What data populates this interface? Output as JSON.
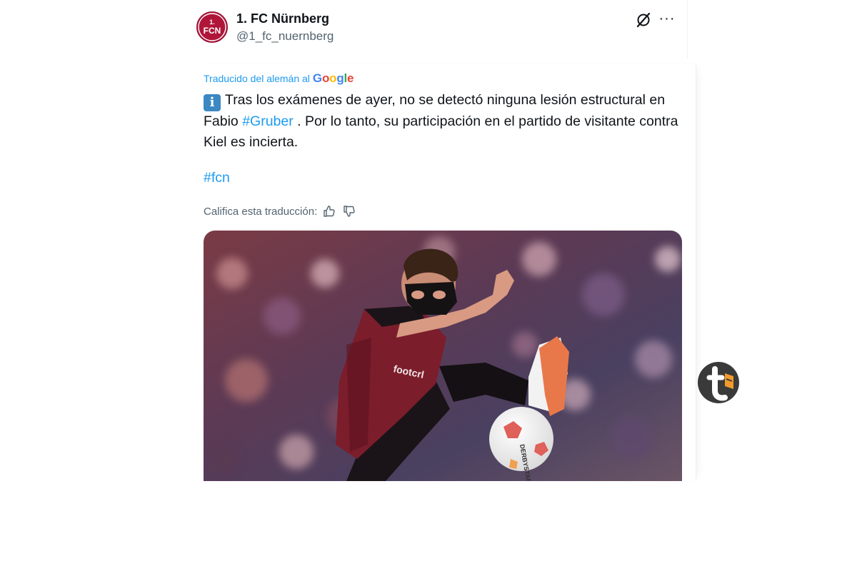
{
  "tweet": {
    "display_name": "1. FC Nürnberg",
    "handle": "@1_fc_nuernberg",
    "avatar": "fcn-logo",
    "header_icons": [
      "grok-icon",
      "more-icon"
    ],
    "more_label": "···"
  },
  "translation": {
    "label": "Traducido del alemán al",
    "provider": [
      "G",
      "o",
      "o",
      "g",
      "l",
      "e"
    ],
    "rate_label": "Califica esta traducción:",
    "rate_icons": [
      "thumbs-up-icon",
      "thumbs-down-icon"
    ]
  },
  "body": {
    "emoji": "info-emoji",
    "emoji_glyph": "i",
    "text_before": "Tras los exámenes de ayer, no se detectó ninguna lesión estructural en Fabio ",
    "hashtag_inline": "#Gruber",
    "text_after": " . Por lo tanto, su participación en el partido de visitante contra Kiel es incierta.",
    "hashtag_footer": "#fcn"
  },
  "media": {
    "jersey_text": "footcrl",
    "ball_text": "DERBYSTAR"
  },
  "colors": {
    "link": "#1d9bf0",
    "text": "#0f1419",
    "secondary": "#536471",
    "club_red": "#b0163a"
  }
}
